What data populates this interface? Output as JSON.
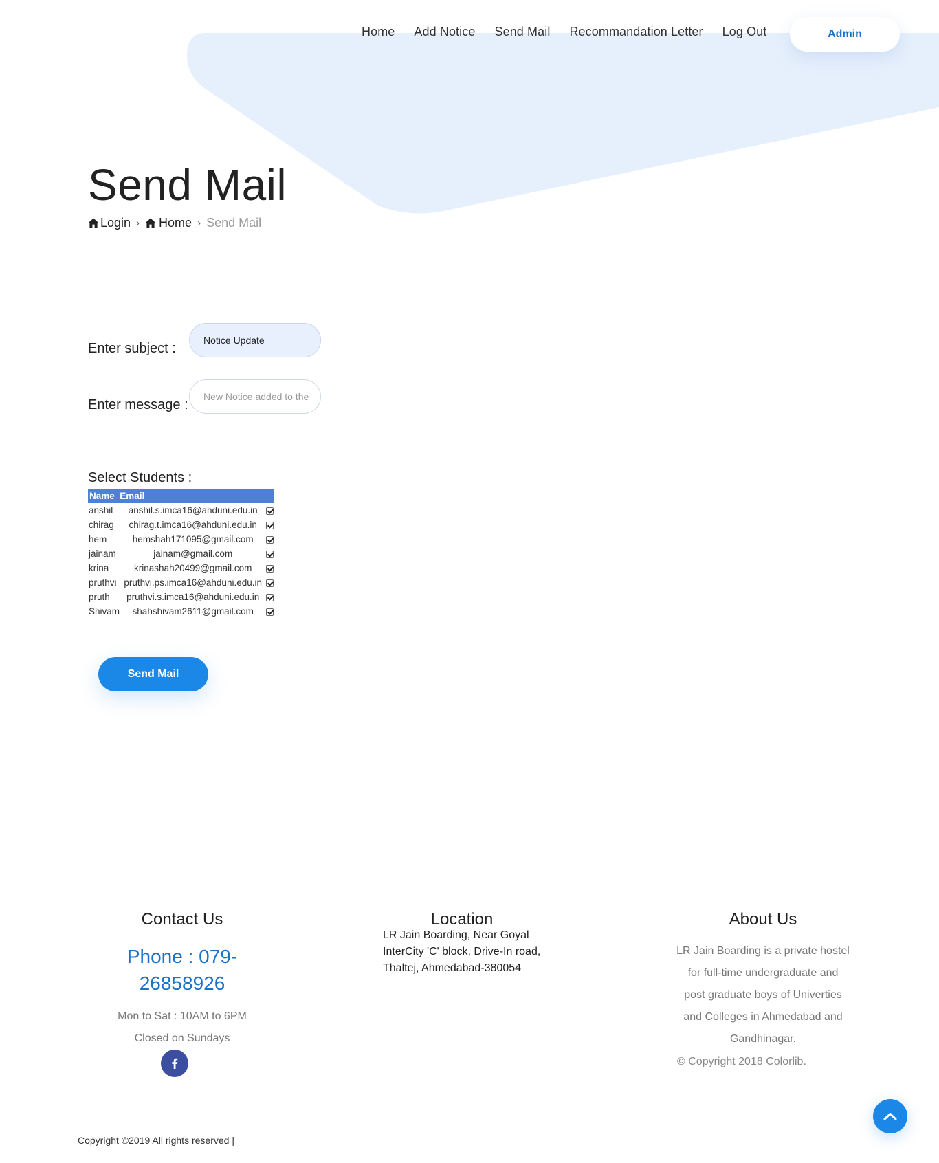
{
  "nav": {
    "items": [
      {
        "label": "Home"
      },
      {
        "label": "Add Notice"
      },
      {
        "label": "Send Mail"
      },
      {
        "label": "Recommandation Letter"
      },
      {
        "label": "Log Out"
      }
    ],
    "admin_label": "Admin"
  },
  "header": {
    "title": "Send Mail",
    "breadcrumb": [
      {
        "label": "Login",
        "icon": "home-icon"
      },
      {
        "label": "Home",
        "icon": "home-icon"
      },
      {
        "label": "Send Mail"
      }
    ]
  },
  "form": {
    "subject_label": "Enter subject :",
    "subject_value": "Notice Update",
    "message_label": "Enter message :",
    "message_placeholder": "New Notice added to the",
    "students_label": "Select Students :",
    "columns": [
      "Name",
      "Email"
    ],
    "students": [
      {
        "name": "anshil",
        "email": "anshil.s.imca16@ahduni.edu.in",
        "checked": true
      },
      {
        "name": "chirag",
        "email": "chirag.t.imca16@ahduni.edu.in",
        "checked": true
      },
      {
        "name": "hem",
        "email": "hemshah171095@gmail.com",
        "checked": true
      },
      {
        "name": "jainam",
        "email": "jainam@gmail.com",
        "checked": true
      },
      {
        "name": "krina",
        "email": "krinashah20499@gmail.com",
        "checked": true
      },
      {
        "name": "pruthvi",
        "email": "pruthvi.ps.imca16@ahduni.edu.in",
        "checked": true
      },
      {
        "name": "pruth",
        "email": "pruthvi.s.imca16@ahduni.edu.in",
        "checked": true
      },
      {
        "name": "Shivam",
        "email": "shahshivam2611@gmail.com",
        "checked": true
      }
    ],
    "submit_label": "Send Mail"
  },
  "footer": {
    "contact": {
      "heading": "Contact Us",
      "phone_line1": "Phone : 079-",
      "phone_line2": "26858926",
      "hours": "Mon to Sat : 10AM to 6PM",
      "closed": "Closed on Sundays",
      "social_icon": "facebook-icon"
    },
    "location": {
      "heading": "Location",
      "address": "LR Jain Boarding, Near Goyal InterCity 'C' block, Drive-In road, Thaltej, Ahmedabad-380054"
    },
    "about": {
      "heading": "About Us",
      "lines": [
        "LR Jain Boarding is a private hostel",
        "for full-time undergraduate and",
        "post graduate boys of Univerties",
        "and Colleges in Ahmedabad and",
        "Gandhinagar."
      ],
      "copyright_prefix": "© Copyright 2018",
      "copyright_brand": "Colorlib."
    },
    "bottom_copyright": "Copyright ©2019 All rights reserved |"
  },
  "colors": {
    "accent": "#1b87e6",
    "link_blue": "#1a73c8",
    "header_shape": "#e6f0fc",
    "table_header": "#4f7fd6",
    "facebook": "#3b4ea0"
  }
}
